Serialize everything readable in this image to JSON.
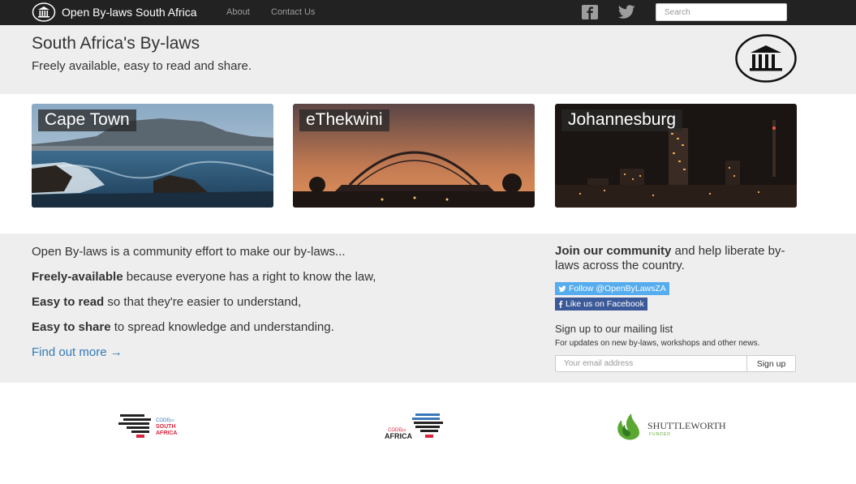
{
  "navbar": {
    "brand": "Open By-laws South Africa",
    "links": [
      "About",
      "Contact Us"
    ],
    "social": [
      "facebook-icon",
      "twitter-icon"
    ],
    "search_placeholder": "Search"
  },
  "jumbotron": {
    "title": "South Africa's By-laws",
    "subtitle": "Freely available, easy to read and share."
  },
  "cities": [
    {
      "name": "Cape Town"
    },
    {
      "name": "eThekwini"
    },
    {
      "name": "Johannesburg"
    }
  ],
  "info": {
    "intro": "Open By-laws is a community effort to make our by-laws...",
    "points": [
      {
        "bold": "Freely-available",
        "rest": " because everyone has a right to know the law,"
      },
      {
        "bold": "Easy to read",
        "rest": " so that they're easier to understand,"
      },
      {
        "bold": "Easy to share",
        "rest": " to spread knowledge and understanding."
      }
    ],
    "find_more": "Find out more →"
  },
  "community": {
    "bold": "Join our community",
    "rest": " and help liberate by-laws across the country.",
    "twitter_button": "Follow @OpenByLawsZA",
    "facebook_button": "Like us on Facebook",
    "mailing_title": "Sign up to our mailing list",
    "mailing_desc": "For updates on new by-laws, workshops and other news.",
    "email_placeholder": "Your email address",
    "signup_label": "Sign up"
  },
  "footer": {
    "logos": [
      {
        "line1": "CODE",
        "line2": "for",
        "line3": "SOUTH",
        "line4": "AFRICA"
      },
      {
        "line1": "CODE",
        "line2": "for",
        "line3": "AFRICA"
      },
      {
        "name": "SHUTTLEWORTH",
        "sub": "FUNDED"
      }
    ]
  },
  "colors": {
    "navbar": "#222222",
    "section_bg": "#eeeeee",
    "link": "#337ab7",
    "twitter": "#55acee",
    "facebook": "#3b5998"
  }
}
